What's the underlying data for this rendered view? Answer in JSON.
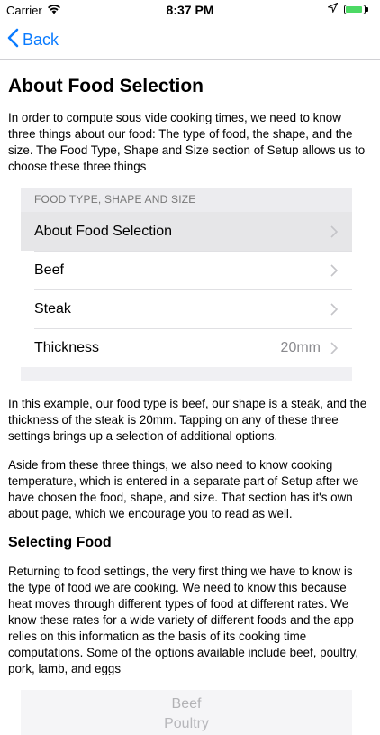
{
  "status_bar": {
    "carrier": "Carrier",
    "time": "8:37 PM",
    "battery_level": 0.9
  },
  "nav": {
    "back_label": "Back"
  },
  "page": {
    "title": "About Food Selection",
    "intro": "In order to compute sous vide cooking times, we need to know three things about our food: The type of food, the shape, and the size. The Food Type, Shape and Size section of Setup allows us to choose these three things",
    "paragraph2": "In this example, our food type is beef, our shape is a steak, and the thickness of the steak is 20mm. Tapping on any of these three settings brings up a selection of additional options.",
    "paragraph3": "Aside from these three things, we also need to know cooking temperature, which is entered in a separate part of Setup after we have chosen the food, shape, and size. That section has it's own about page, which we encourage you to read as well.",
    "section_heading": "Selecting Food",
    "paragraph4": "Returning to food settings, the very first thing we have to know is the type of food we are cooking. We need to know this because heat moves through different types of food at different rates. We know these rates for a wide variety of different foods and the app relies on this information as the basis of its cooking time computations. Some of the options available include beef, poultry, pork, lamb, and eggs"
  },
  "settings_example": {
    "header": "FOOD TYPE, SHAPE AND SIZE",
    "rows": [
      {
        "label": "About Food Selection",
        "value": ""
      },
      {
        "label": "Beef",
        "value": ""
      },
      {
        "label": "Steak",
        "value": ""
      },
      {
        "label": "Thickness",
        "value": "20mm"
      }
    ]
  },
  "picker_example": {
    "items": [
      "Beef",
      "Poultry"
    ]
  },
  "colors": {
    "accent": "#0a7bff",
    "battery": "#4cd964"
  }
}
